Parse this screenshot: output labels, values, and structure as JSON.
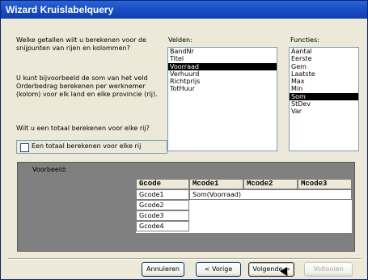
{
  "window": {
    "title": "Wizard Kruislabelquery"
  },
  "instructions": {
    "question": "Welke getallen wilt u berekenen voor de snijpunten van rijen en kolommen?",
    "example": "U kunt bijvoorbeeld de som van het veld Orderbedrag berekenen per werknemer (kolom) voor elk land en elke provincie (rij).",
    "total_question": "Wilt u een totaal berekenen voor elke rij?"
  },
  "fields": {
    "label": "Velden:",
    "items": [
      "BandNr",
      "Titel",
      "Voorraad",
      "Verhuurd",
      "Richtprijs",
      "TotHuur"
    ],
    "selected": "Voorraad"
  },
  "functions": {
    "label": "Functies:",
    "items": [
      "Aantal",
      "Eerste",
      "Gem",
      "Laatste",
      "Max",
      "Min",
      "Som",
      "StDev",
      "Var"
    ],
    "selected": "Som"
  },
  "total_checkbox": {
    "label": "Een totaal berekenen voor elke rij",
    "checked": false
  },
  "preview": {
    "label": "Voorbeeld:",
    "columns": [
      "Gcode",
      "Mcode1",
      "Mcode2",
      "Mcode3"
    ],
    "rows": [
      "Gcode1",
      "Gcode2",
      "Gcode3",
      "Gcode4"
    ],
    "cell_value": "Som(Voorraad)"
  },
  "buttons": {
    "cancel": "Annuleren",
    "back": "< Vorige",
    "next": "Volgende >",
    "finish": "Voltooien"
  }
}
